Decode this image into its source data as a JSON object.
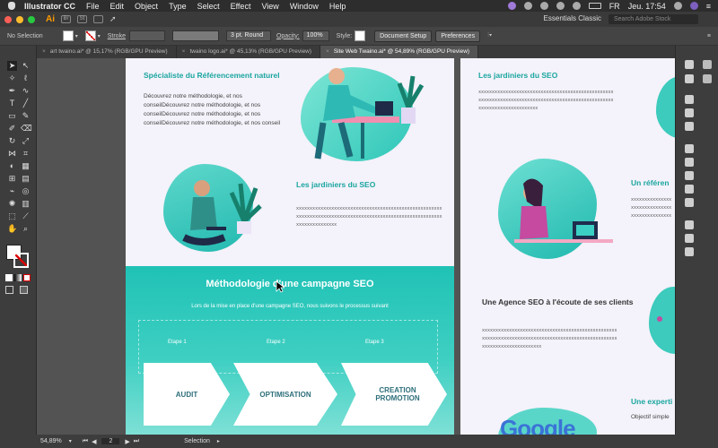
{
  "menubar": {
    "app": "Illustrator CC",
    "items": [
      "File",
      "Edit",
      "Object",
      "Type",
      "Select",
      "Effect",
      "View",
      "Window",
      "Help"
    ],
    "flag": "FR",
    "clock": "Jeu. 17:54"
  },
  "appbar": {
    "logo": "Ai",
    "br": "Br",
    "st": "St",
    "workspace": "Essentials Classic",
    "search_placeholder": "Search Adobe Stock"
  },
  "control": {
    "selection": "No Selection",
    "stroke_label": "Stroke",
    "brush": "3 pt. Round",
    "opacity_label": "Opacity:",
    "opacity_value": "100%",
    "style_label": "Style:",
    "doc_setup": "Document Setup",
    "preferences": "Preferences"
  },
  "tabs": [
    {
      "label": "art twaino.ai* @ 15,17% (RGB/GPU Preview)"
    },
    {
      "label": "twaino logo.ai* @ 45,13% (RGB/GPU Preview)"
    },
    {
      "label": "Site Web Twaino.ai* @ 54,89% (RGB/GPU Preview)"
    }
  ],
  "art1": {
    "s1_title": "Spécialiste du Référencement naturel",
    "s1_body": "Découvrez notre méthodologie, et nos conseilDécouvrez notre méthodologie, et nos conseilDécouvrez notre méthodologie, et nos conseilDécouvrez notre méthodologie, et nos conseil",
    "s2_title": "Les jardiniers du SEO",
    "s2_x1": "xxxxxxxxxxxxxxxxxxxxxxxxxxxxxxxxxxxxxxxxxxxxxxxxxxxxxx",
    "s2_x2": "xxxxxxxxxxxxxxxxxxxxxxxxxxxxxxxxxxxxxxxxxxxxxxxxxxxxxx",
    "s2_x3": "xxxxxxxxxxxxxxx",
    "band_title": "Méthodologie d'une campagne SEO",
    "band_lead": "Lors de la mise en place d'une campagne SEO, nous suivons le processus suivant",
    "steps": [
      "Etape 1",
      "Etape 2",
      "Etape 3"
    ],
    "chevrons": [
      "AUDIT",
      "OPTIMISATION",
      "CREATION PROMOTION"
    ]
  },
  "art2": {
    "t1": "Les jardiniers du SEO",
    "x1": "xxxxxxxxxxxxxxxxxxxxxxxxxxxxxxxxxxxxxxxxxxxxxxxxxx",
    "x2": "xxxxxxxxxxxxxxxxxxxxxxxxxxxxxxxxxxxxxxxxxxxxxxxxxx",
    "x3": "xxxxxxxxxxxxxxxxxxxxxx",
    "t_right1": "Un référen",
    "xr1": "xxxxxxxxxxxxxxx",
    "xr2": "xxxxxxxxxxxxxxx",
    "xr3": "xxxxxxxxxxxxxxx",
    "t2": "Une Agence SEO à l'écoute de ses clients",
    "y1": "xxxxxxxxxxxxxxxxxxxxxxxxxxxxxxxxxxxxxxxxxxxxxxxxxx",
    "y2": "xxxxxxxxxxxxxxxxxxxxxxxxxxxxxxxxxxxxxxxxxxxxxxxxxx",
    "y3": "xxxxxxxxxxxxxxxxxxxxxx",
    "t_right2": "Une experti",
    "body_right2": "Objectif simple",
    "google": "Google"
  },
  "status": {
    "zoom": "54,89%",
    "page": "2",
    "mode": "Selection"
  },
  "colors": {
    "teal": "#1aa6a0",
    "band": "#20c2b6",
    "artboard": "#f4f2fa"
  }
}
